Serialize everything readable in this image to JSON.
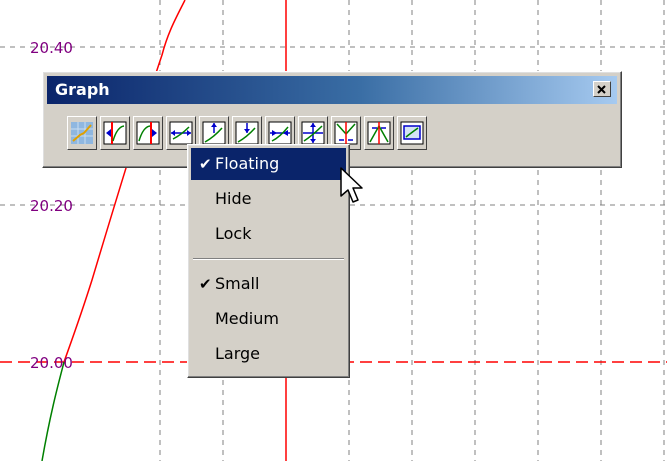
{
  "plot": {
    "y_ticks": [
      "20.40",
      "20.20",
      "20.00"
    ],
    "colors": {
      "grid": "#808080",
      "red_curve": "#ff0000",
      "green_curve": "#008000",
      "tick_label": "#800080"
    }
  },
  "toolbar": {
    "title": "Graph",
    "close_icon": "close-icon",
    "buttons": [
      {
        "icon": "grid-plot-icon"
      },
      {
        "icon": "cursor-left-icon"
      },
      {
        "icon": "cursor-right-icon"
      },
      {
        "icon": "expand-horizontal-icon"
      },
      {
        "icon": "move-up-icon"
      },
      {
        "icon": "move-down-icon"
      },
      {
        "icon": "shrink-horizontal-icon"
      },
      {
        "icon": "expand-vertical-icon"
      },
      {
        "icon": "compress-vertical-icon"
      },
      {
        "icon": "zoom-in-icon"
      },
      {
        "icon": "fit-graph-icon"
      }
    ]
  },
  "context_menu": {
    "items": [
      {
        "label": "Floating",
        "checked": true,
        "highlighted": true
      },
      {
        "label": "Hide",
        "checked": false
      },
      {
        "label": "Lock",
        "checked": false
      },
      {
        "label": "Small",
        "checked": true
      },
      {
        "label": "Medium",
        "checked": false
      },
      {
        "label": "Large",
        "checked": false
      }
    ],
    "check_glyph": "✔"
  }
}
